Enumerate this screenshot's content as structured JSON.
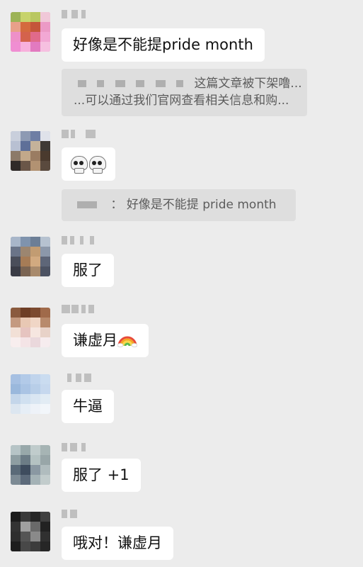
{
  "messages": [
    {
      "text": "好像是不能提pride month"
    },
    {
      "text_before": "",
      "text": "",
      "emoji": [
        "skull-emoji",
        "skull-emoji"
      ]
    },
    {
      "text": "服了"
    },
    {
      "text": "谦虚月",
      "emoji": [
        "rainbow-emoji"
      ]
    },
    {
      "text": "牛逼"
    },
    {
      "text": "服了 +1"
    },
    {
      "text": "哦对！谦虚月"
    }
  ],
  "quotes": [
    {
      "line1": "这篇文章被下架噜...",
      "line2": "...可以通过我们官网查看相关信息和购..."
    },
    {
      "separator": "：",
      "text": "好像是不能提 pride month"
    }
  ],
  "colors": {
    "background": "#ececec",
    "bubble": "#ffffff",
    "quote": "#dedede",
    "redacted": "#9a9a9a"
  }
}
